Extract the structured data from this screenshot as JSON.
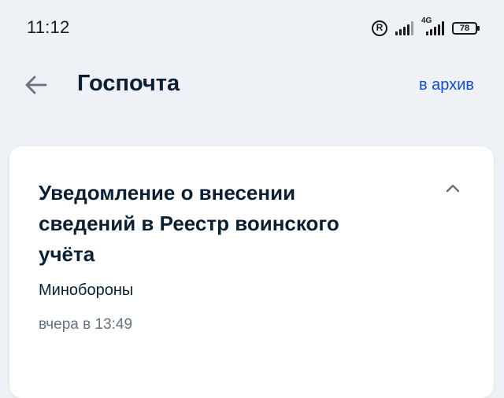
{
  "status_bar": {
    "time": "11:12",
    "registered_icon": "R",
    "network_label": "4G",
    "battery": "78"
  },
  "header": {
    "back_icon": "arrow-left-icon",
    "title": "Госпочта",
    "archive_link": "в архив",
    "accent_color": "#0d4cd3"
  },
  "message": {
    "title": "Уведомление о внесении сведений в Реестр воинского учёта",
    "sender": "Минобороны",
    "timestamp": "вчера в 13:49",
    "collapse_icon": "chevron-up-icon"
  }
}
